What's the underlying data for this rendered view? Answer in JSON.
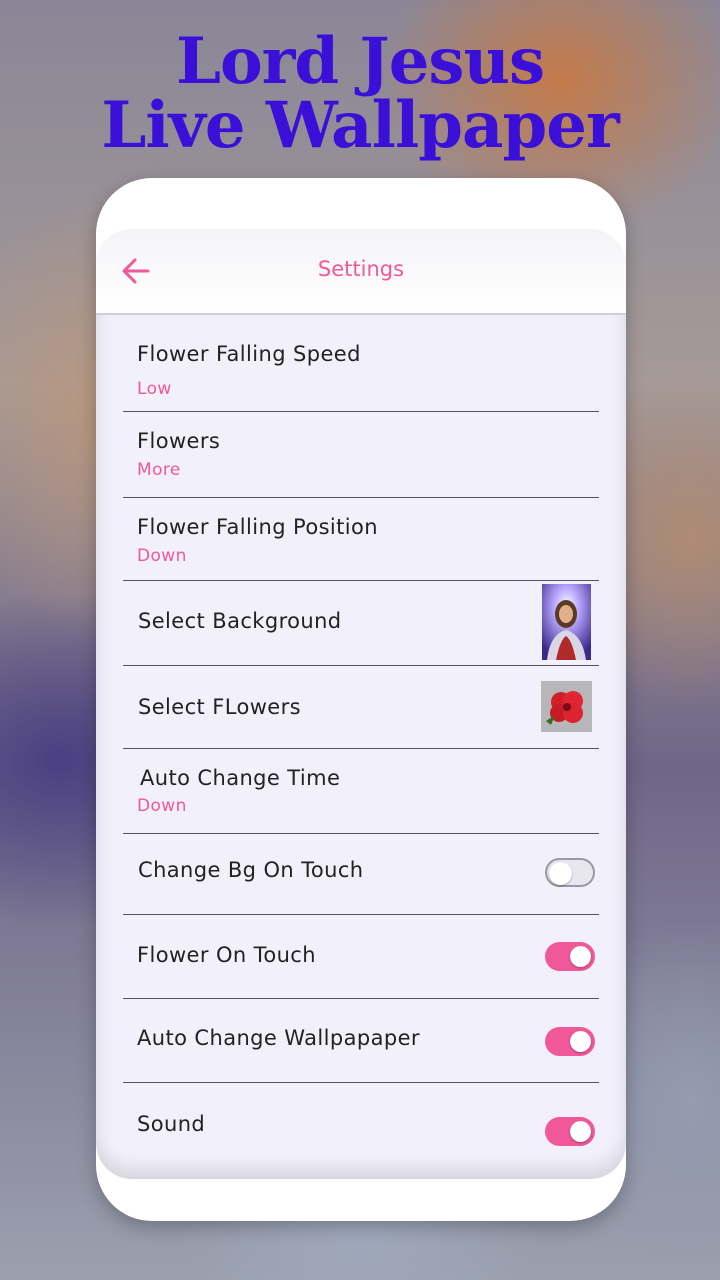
{
  "promo": {
    "line1": "Lord Jesus",
    "line2": "Live Wallpaper"
  },
  "appbar": {
    "title": "Settings",
    "back_icon": "arrow-left-icon"
  },
  "colors": {
    "accent": "#f0589a",
    "promo_title": "#3a10d8",
    "toggle_off": "#e8e7ef"
  },
  "settings": {
    "speed": {
      "title": "Flower Falling Speed",
      "value": "Low"
    },
    "flowers": {
      "title": "Flowers",
      "value": "More"
    },
    "position": {
      "title": "Flower Falling Position",
      "value": "Down"
    },
    "background": {
      "title": "Select Background",
      "thumbnail": "jesus-portrait-image"
    },
    "select_flowers": {
      "title": "Select FLowers",
      "thumbnail": "red-hibiscus-image"
    },
    "auto_time": {
      "title": "Auto Change Time",
      "value": "Down"
    },
    "bg_touch": {
      "title": "Change Bg On Touch",
      "enabled": false
    },
    "flower_touch": {
      "title": "Flower On Touch",
      "enabled": true
    },
    "auto_wallpaper": {
      "title": "Auto Change Wallpapaper",
      "enabled": true
    },
    "sound": {
      "title": "Sound",
      "enabled": true
    }
  }
}
